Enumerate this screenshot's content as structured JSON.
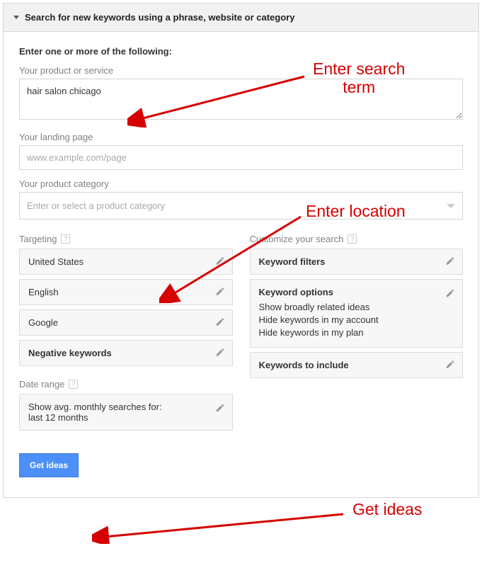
{
  "header": {
    "title": "Search for new keywords using a phrase, website or category"
  },
  "section": {
    "title": "Enter one or more of the following:"
  },
  "fields": {
    "product_label": "Your product or service",
    "product_value": "hair salon chicago",
    "landing_label": "Your landing page",
    "landing_placeholder": "www.example.com/page",
    "category_label": "Your product category",
    "category_placeholder": "Enter or select a product category"
  },
  "targeting": {
    "label": "Targeting",
    "location": "United States",
    "language": "English",
    "network": "Google",
    "negative": "Negative keywords"
  },
  "dateRange": {
    "label": "Date range",
    "text": "Show avg. monthly searches for: last 12 months"
  },
  "customize": {
    "label": "Customize your search",
    "filters": "Keyword filters",
    "options_title": "Keyword options",
    "opt1": "Show broadly related ideas",
    "opt2": "Hide keywords in my account",
    "opt3": "Hide keywords in my plan",
    "include": "Keywords to include"
  },
  "button": {
    "get_ideas": "Get ideas"
  },
  "annotations": {
    "a1": "Enter search term",
    "a2": "Enter location",
    "a3": "Get ideas"
  }
}
